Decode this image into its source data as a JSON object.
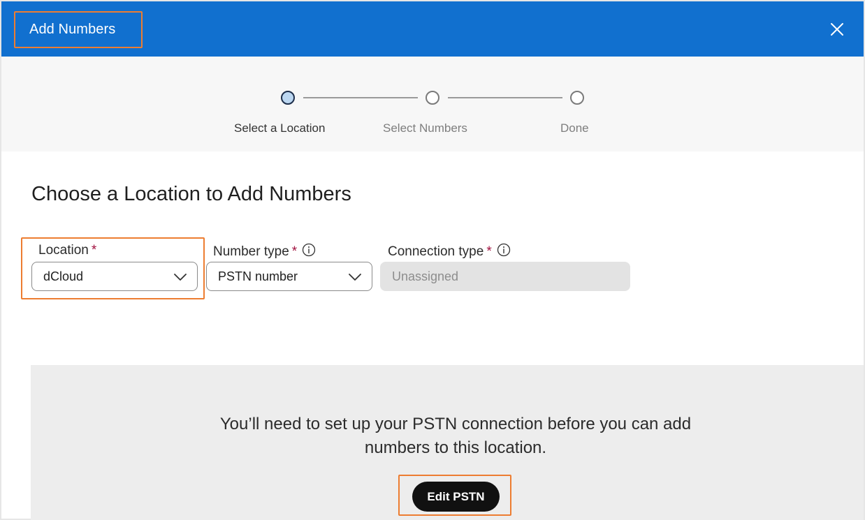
{
  "dialog": {
    "title": "Add Numbers",
    "close_icon": "close-icon"
  },
  "stepper": {
    "steps": [
      {
        "label": "Select a Location",
        "state": "active"
      },
      {
        "label": "Select Numbers",
        "state": "pending"
      },
      {
        "label": "Done",
        "state": "pending"
      }
    ]
  },
  "main": {
    "heading": "Choose a Location to Add Numbers",
    "fields": {
      "location": {
        "label": "Location",
        "required_mark": "*",
        "value": "dCloud"
      },
      "number_type": {
        "label": "Number type",
        "required_mark": "*",
        "value": "PSTN number",
        "info_icon": "info-icon"
      },
      "connection_type": {
        "label": "Connection type",
        "required_mark": "*",
        "value": "Unassigned",
        "info_icon": "info-icon"
      }
    }
  },
  "notice": {
    "line1": "You’ll need to set up your PSTN connection before you can add",
    "line2": "numbers to this location.",
    "button_label": "Edit PSTN"
  },
  "colors": {
    "header_bg": "#1170cf",
    "highlight": "#ed7d31",
    "required": "#a1113f",
    "button_bg": "#111111"
  }
}
